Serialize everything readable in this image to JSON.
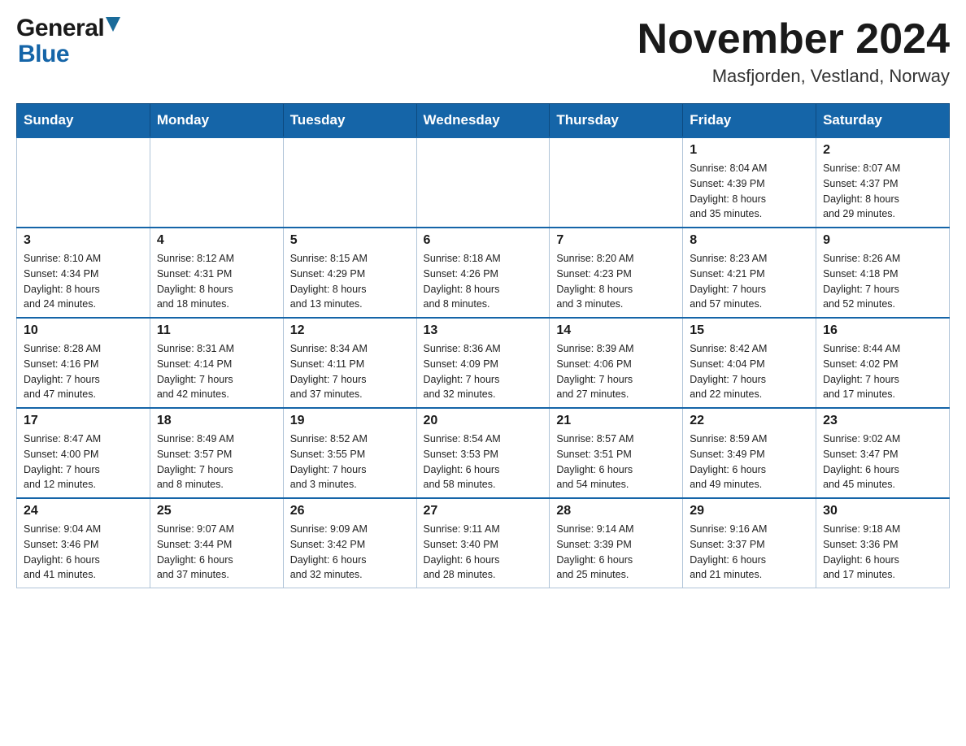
{
  "logo": {
    "line1": "General",
    "line2": "Blue"
  },
  "title": {
    "month_year": "November 2024",
    "location": "Masfjorden, Vestland, Norway"
  },
  "days_of_week": [
    "Sunday",
    "Monday",
    "Tuesday",
    "Wednesday",
    "Thursday",
    "Friday",
    "Saturday"
  ],
  "weeks": [
    [
      {
        "day": "",
        "info": ""
      },
      {
        "day": "",
        "info": ""
      },
      {
        "day": "",
        "info": ""
      },
      {
        "day": "",
        "info": ""
      },
      {
        "day": "",
        "info": ""
      },
      {
        "day": "1",
        "info": "Sunrise: 8:04 AM\nSunset: 4:39 PM\nDaylight: 8 hours\nand 35 minutes."
      },
      {
        "day": "2",
        "info": "Sunrise: 8:07 AM\nSunset: 4:37 PM\nDaylight: 8 hours\nand 29 minutes."
      }
    ],
    [
      {
        "day": "3",
        "info": "Sunrise: 8:10 AM\nSunset: 4:34 PM\nDaylight: 8 hours\nand 24 minutes."
      },
      {
        "day": "4",
        "info": "Sunrise: 8:12 AM\nSunset: 4:31 PM\nDaylight: 8 hours\nand 18 minutes."
      },
      {
        "day": "5",
        "info": "Sunrise: 8:15 AM\nSunset: 4:29 PM\nDaylight: 8 hours\nand 13 minutes."
      },
      {
        "day": "6",
        "info": "Sunrise: 8:18 AM\nSunset: 4:26 PM\nDaylight: 8 hours\nand 8 minutes."
      },
      {
        "day": "7",
        "info": "Sunrise: 8:20 AM\nSunset: 4:23 PM\nDaylight: 8 hours\nand 3 minutes."
      },
      {
        "day": "8",
        "info": "Sunrise: 8:23 AM\nSunset: 4:21 PM\nDaylight: 7 hours\nand 57 minutes."
      },
      {
        "day": "9",
        "info": "Sunrise: 8:26 AM\nSunset: 4:18 PM\nDaylight: 7 hours\nand 52 minutes."
      }
    ],
    [
      {
        "day": "10",
        "info": "Sunrise: 8:28 AM\nSunset: 4:16 PM\nDaylight: 7 hours\nand 47 minutes."
      },
      {
        "day": "11",
        "info": "Sunrise: 8:31 AM\nSunset: 4:14 PM\nDaylight: 7 hours\nand 42 minutes."
      },
      {
        "day": "12",
        "info": "Sunrise: 8:34 AM\nSunset: 4:11 PM\nDaylight: 7 hours\nand 37 minutes."
      },
      {
        "day": "13",
        "info": "Sunrise: 8:36 AM\nSunset: 4:09 PM\nDaylight: 7 hours\nand 32 minutes."
      },
      {
        "day": "14",
        "info": "Sunrise: 8:39 AM\nSunset: 4:06 PM\nDaylight: 7 hours\nand 27 minutes."
      },
      {
        "day": "15",
        "info": "Sunrise: 8:42 AM\nSunset: 4:04 PM\nDaylight: 7 hours\nand 22 minutes."
      },
      {
        "day": "16",
        "info": "Sunrise: 8:44 AM\nSunset: 4:02 PM\nDaylight: 7 hours\nand 17 minutes."
      }
    ],
    [
      {
        "day": "17",
        "info": "Sunrise: 8:47 AM\nSunset: 4:00 PM\nDaylight: 7 hours\nand 12 minutes."
      },
      {
        "day": "18",
        "info": "Sunrise: 8:49 AM\nSunset: 3:57 PM\nDaylight: 7 hours\nand 8 minutes."
      },
      {
        "day": "19",
        "info": "Sunrise: 8:52 AM\nSunset: 3:55 PM\nDaylight: 7 hours\nand 3 minutes."
      },
      {
        "day": "20",
        "info": "Sunrise: 8:54 AM\nSunset: 3:53 PM\nDaylight: 6 hours\nand 58 minutes."
      },
      {
        "day": "21",
        "info": "Sunrise: 8:57 AM\nSunset: 3:51 PM\nDaylight: 6 hours\nand 54 minutes."
      },
      {
        "day": "22",
        "info": "Sunrise: 8:59 AM\nSunset: 3:49 PM\nDaylight: 6 hours\nand 49 minutes."
      },
      {
        "day": "23",
        "info": "Sunrise: 9:02 AM\nSunset: 3:47 PM\nDaylight: 6 hours\nand 45 minutes."
      }
    ],
    [
      {
        "day": "24",
        "info": "Sunrise: 9:04 AM\nSunset: 3:46 PM\nDaylight: 6 hours\nand 41 minutes."
      },
      {
        "day": "25",
        "info": "Sunrise: 9:07 AM\nSunset: 3:44 PM\nDaylight: 6 hours\nand 37 minutes."
      },
      {
        "day": "26",
        "info": "Sunrise: 9:09 AM\nSunset: 3:42 PM\nDaylight: 6 hours\nand 32 minutes."
      },
      {
        "day": "27",
        "info": "Sunrise: 9:11 AM\nSunset: 3:40 PM\nDaylight: 6 hours\nand 28 minutes."
      },
      {
        "day": "28",
        "info": "Sunrise: 9:14 AM\nSunset: 3:39 PM\nDaylight: 6 hours\nand 25 minutes."
      },
      {
        "day": "29",
        "info": "Sunrise: 9:16 AM\nSunset: 3:37 PM\nDaylight: 6 hours\nand 21 minutes."
      },
      {
        "day": "30",
        "info": "Sunrise: 9:18 AM\nSunset: 3:36 PM\nDaylight: 6 hours\nand 17 minutes."
      }
    ]
  ]
}
